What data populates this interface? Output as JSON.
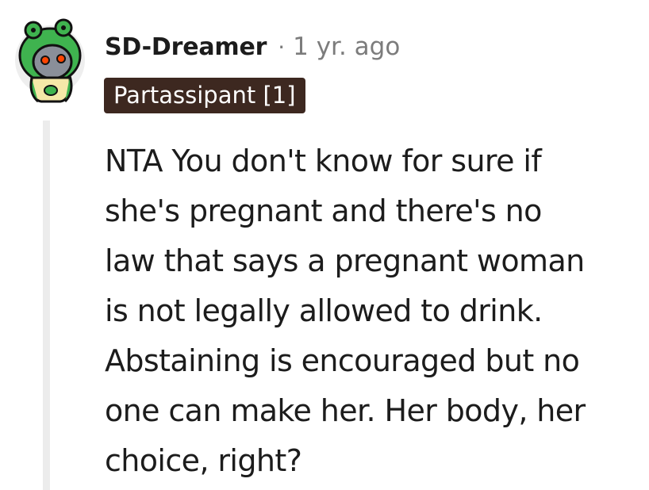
{
  "comment": {
    "username": "SD-Dreamer",
    "separator": "·",
    "timestamp": "1 yr. ago",
    "flair": "Partassipant [1]",
    "body_lines": [
      "NTA You don't know for sure if",
      "she's pregnant and there's no",
      "law that says a pregnant woman",
      "is not legally allowed to drink.",
      "Abstaining is encouraged but no",
      "one can make her. Her body, her",
      "choice, right?"
    ],
    "avatar_icon": "snoo-frog-hood-avatar-icon"
  },
  "colors": {
    "flair_bg": "#3d2820",
    "flair_text": "#ffffff",
    "meta_gray": "#7c7c7c",
    "thread_line": "#ececec",
    "avatar_green": "#3fb34f",
    "avatar_eye": "#ff4500"
  }
}
